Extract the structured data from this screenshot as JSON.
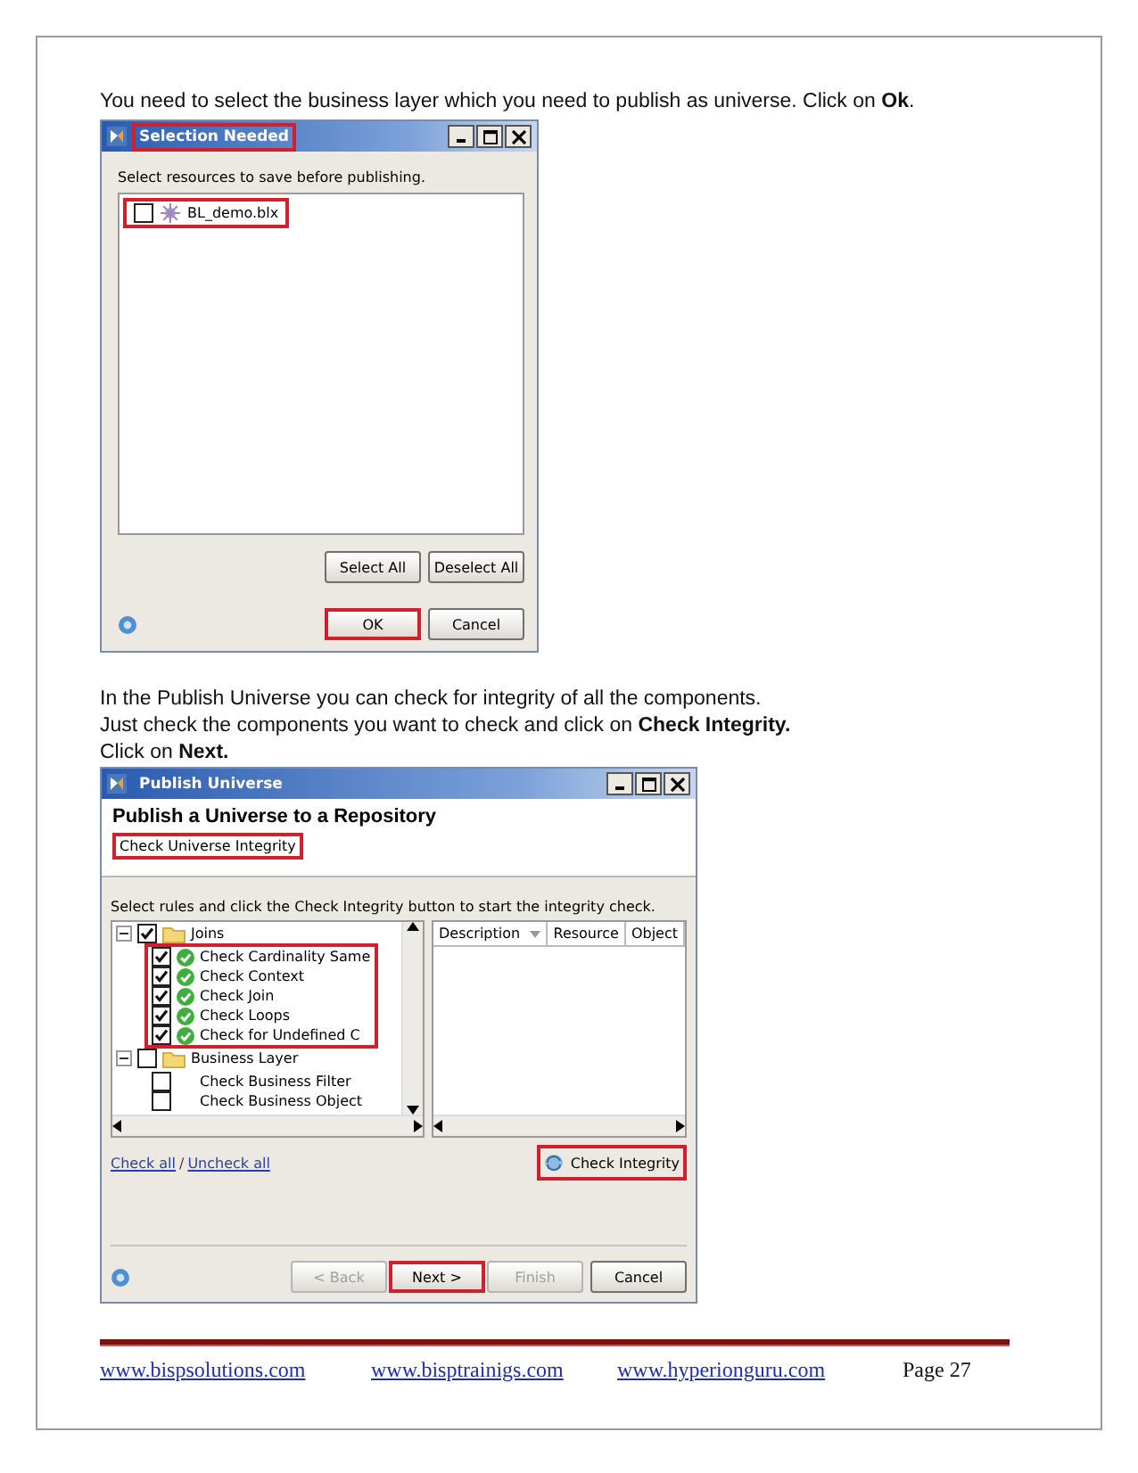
{
  "instructions_top": [
    "You need to select the business layer which you need to publish as universe. Click on **Ok**."
  ],
  "selection_dialog": {
    "title": "Selection Needed",
    "title_highlighted": true,
    "prompt": "Select resources to save before publishing.",
    "resources": [
      {
        "name": "BL_demo.blx",
        "checked": false,
        "highlighted": true
      }
    ],
    "list_buttons": [
      {
        "label": "Select All",
        "highlighted": false
      },
      {
        "label": "Deselect All",
        "highlighted": false
      }
    ],
    "footer_buttons": [
      {
        "label": "OK",
        "highlighted": true
      },
      {
        "label": "Cancel",
        "highlighted": false
      }
    ]
  },
  "instructions_middle": [
    "In the Publish Universe you can check for integrity of all the components.",
    "Just check the components you want to check and click on **Check Integrity.**",
    "Click on **Next.**"
  ],
  "publish_dialog": {
    "title": "Publish Universe",
    "heading": "Publish a Universe to a Repository",
    "step": "Check Universe Integrity",
    "step_highlighted": true,
    "prompt": "Select rules and click the Check Integrity button to start the integrity check.",
    "rules": [
      {
        "label": "Joins",
        "checked": true,
        "expanded": true,
        "children_highlighted": true,
        "children": [
          {
            "label": "Check Cardinality Same",
            "checked": true,
            "passed": true
          },
          {
            "label": "Check Context",
            "checked": true,
            "passed": true
          },
          {
            "label": "Check Join",
            "checked": true,
            "passed": true
          },
          {
            "label": "Check Loops",
            "checked": true,
            "passed": true
          },
          {
            "label": "Check for Undefined C",
            "checked": true,
            "passed": true
          }
        ]
      },
      {
        "label": "Business Layer",
        "checked": false,
        "expanded": true,
        "children": [
          {
            "label": "Check Business Filter",
            "checked": false,
            "passed": false
          },
          {
            "label": "Check Business Object",
            "checked": false,
            "passed": false
          }
        ]
      }
    ],
    "columns": [
      {
        "label": "Description",
        "sorted": true
      },
      {
        "label": "Resource",
        "sorted": false
      },
      {
        "label": "Object",
        "sorted": false
      }
    ],
    "links": [
      "Check all",
      "Uncheck all"
    ],
    "link_separator": "/",
    "check_button": {
      "label": "Check Integrity",
      "highlighted": true
    },
    "footer_buttons": [
      {
        "label": "< Back",
        "disabled": true,
        "highlighted": false
      },
      {
        "label": "Next >",
        "disabled": false,
        "highlighted": true
      },
      {
        "label": "Finish",
        "disabled": true,
        "highlighted": false
      },
      {
        "label": "Cancel",
        "disabled": false,
        "highlighted": false
      }
    ]
  },
  "footer": {
    "links": [
      "www.bispsolutions.com",
      "www.bisptrainigs.com",
      "www.hyperionguru.com"
    ],
    "page": "Page 27"
  }
}
